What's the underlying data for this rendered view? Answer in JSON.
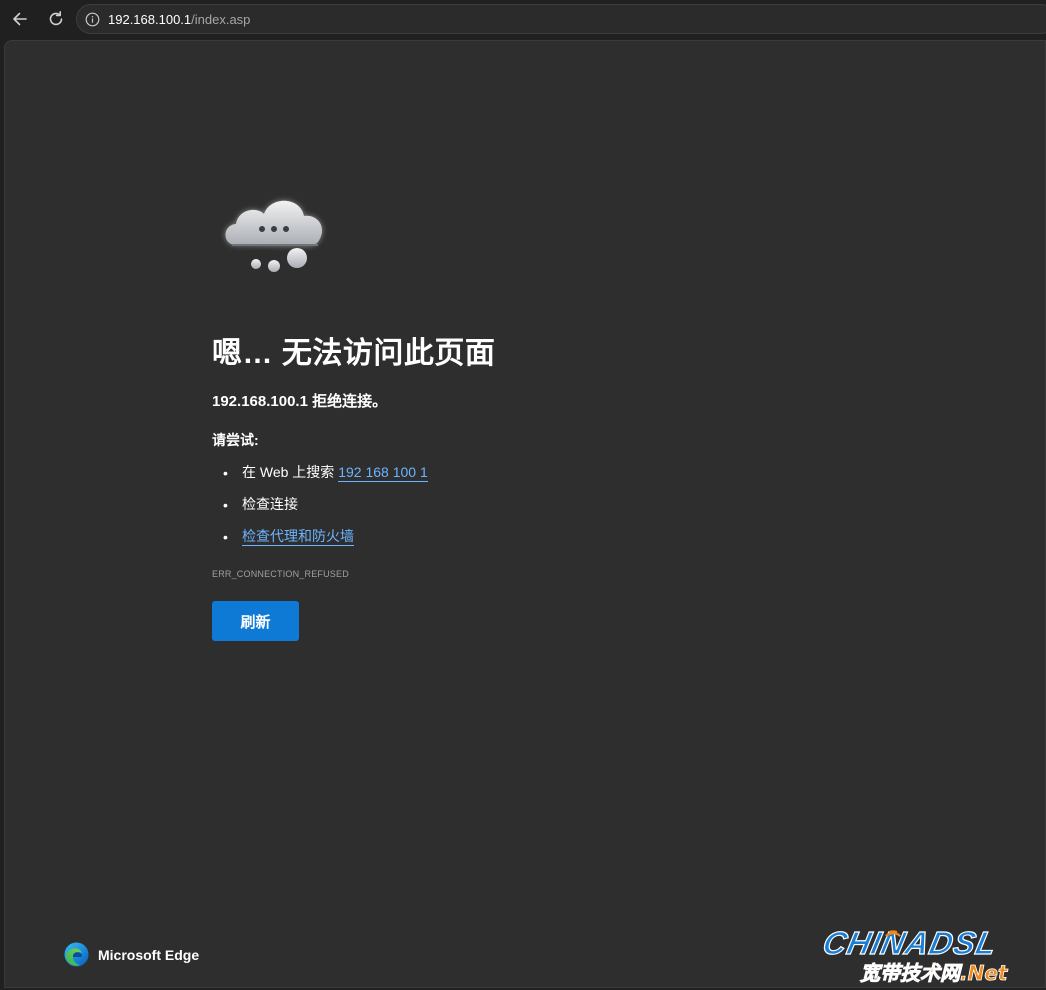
{
  "browser": {
    "url_host": "192.168.100.1",
    "url_path": "/index.asp",
    "icons": {
      "back": "back-arrow-icon",
      "refresh": "refresh-icon",
      "info": "info-icon"
    }
  },
  "error_page": {
    "title": "嗯… 无法访问此页面",
    "subtitle": "192.168.100.1 拒绝连接。",
    "try_label": "请尝试:",
    "suggestions": [
      {
        "text": "在 Web 上搜索 ",
        "link": "192 168 100 1"
      },
      {
        "text": "检查连接",
        "link": ""
      },
      {
        "text": "",
        "link": "检查代理和防火墙"
      }
    ],
    "error_code": "ERR_CONNECTION_REFUSED",
    "refresh_label": "刷新",
    "illustration": "cloud-icon"
  },
  "footer": {
    "brand_name": "Microsoft Edge",
    "brand_icon": "edge-logo-icon"
  },
  "watermark": {
    "line1": "CHINADSL",
    "line2": "宽带技术网.Net",
    "colors": {
      "blue": "#1a7fd4",
      "orange": "#f08a1c"
    }
  },
  "colors": {
    "page_background": "#2e2e2e",
    "toolbar_background": "#202020",
    "link": "#6cb4ff",
    "button": "#0f7ad6"
  }
}
